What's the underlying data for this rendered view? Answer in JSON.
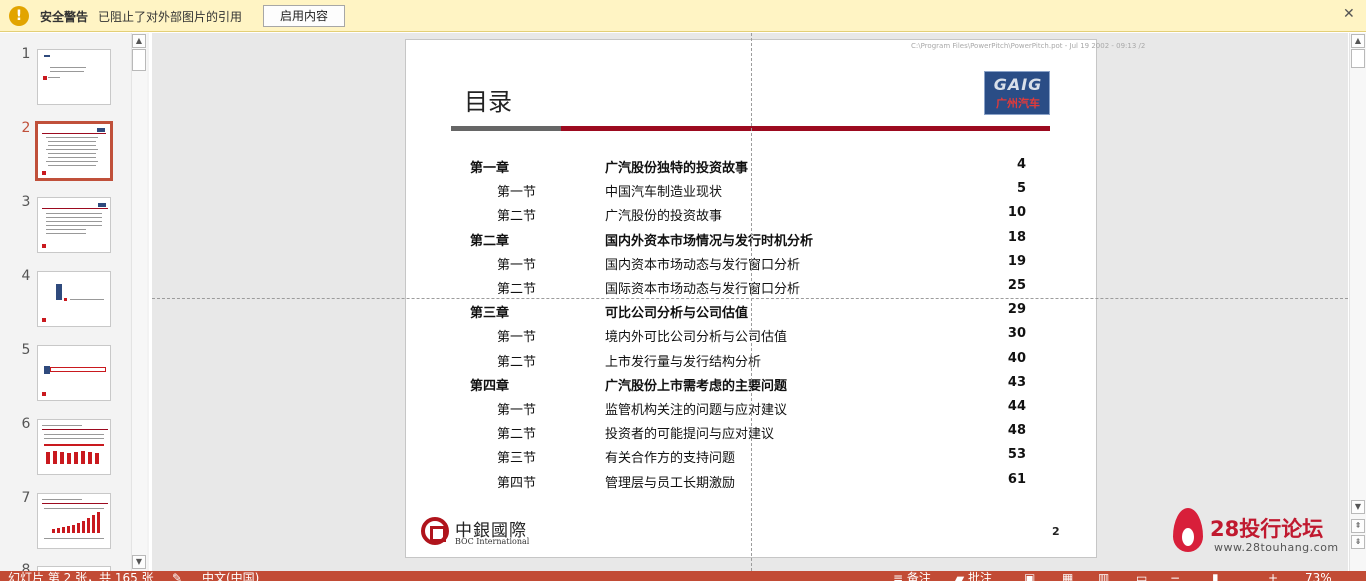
{
  "security_bar": {
    "icon": "warning-shield-icon",
    "title": "安全警告",
    "message": "已阻止了对外部图片的引用",
    "enable_button": "启用内容"
  },
  "thumbnails": [
    {
      "num": "1",
      "active": false
    },
    {
      "num": "2",
      "active": true
    },
    {
      "num": "3",
      "active": false
    },
    {
      "num": "4",
      "active": false
    },
    {
      "num": "5",
      "active": false
    },
    {
      "num": "6",
      "active": false
    },
    {
      "num": "7",
      "active": false
    },
    {
      "num": "8",
      "active": false
    }
  ],
  "slide": {
    "file_path": "C:\\Program Files\\PowerPitch\\PowerPitch.pot - Jul 19 2002 - 09:13 /2",
    "title": "目录",
    "brand_logo": {
      "top": "GAIG",
      "bottom": "广州汽车"
    },
    "toc": [
      {
        "label": "第一章",
        "title": "广汽股份独特的投资故事",
        "page": "4",
        "chapter": true
      },
      {
        "label": "第一节",
        "title": "中国汽车制造业现状",
        "page": "5",
        "chapter": false
      },
      {
        "label": "第二节",
        "title": "广汽股份的投资故事",
        "page": "10",
        "chapter": false
      },
      {
        "label": "第二章",
        "title": "国内外资本市场情况与发行时机分析",
        "page": "18",
        "chapter": true
      },
      {
        "label": "第一节",
        "title": "国内资本市场动态与发行窗口分析",
        "page": "19",
        "chapter": false
      },
      {
        "label": "第二节",
        "title": "国际资本市场动态与发行窗口分析",
        "page": "25",
        "chapter": false
      },
      {
        "label": "第三章",
        "title": "可比公司分析与公司估值",
        "page": "29",
        "chapter": true
      },
      {
        "label": "第一节",
        "title": "境内外可比公司分析与公司估值",
        "page": "30",
        "chapter": false
      },
      {
        "label": "第二节",
        "title": "上市发行量与发行结构分析",
        "page": "40",
        "chapter": false
      },
      {
        "label": "第四章",
        "title": "广汽股份上市需考虑的主要问题",
        "page": "43",
        "chapter": true
      },
      {
        "label": "第一节",
        "title": "监管机构关注的问题与应对建议",
        "page": "44",
        "chapter": false
      },
      {
        "label": "第二节",
        "title": "投资者的可能提问与应对建议",
        "page": "48",
        "chapter": false
      },
      {
        "label": "第三节",
        "title": "有关合作方的支持问题",
        "page": "53",
        "chapter": false
      },
      {
        "label": "第四节",
        "title": "管理层与员工长期激励",
        "page": "61",
        "chapter": false
      }
    ],
    "footer_logo_cn": "中銀國際",
    "footer_logo_en": "BOC International",
    "page_number": "2"
  },
  "watermark": {
    "text": "28投行论坛",
    "url": "www.28touhang.com"
  },
  "status_bar": {
    "slide_info": "幻灯片 第 2 张，共 165 张",
    "language": "中文(中国)",
    "notes": "备注",
    "comments": "批注",
    "zoom": "73%"
  },
  "colors": {
    "accent": "#c24b35",
    "brand_red": "#9c0a1f",
    "security_bar": "#fff4c4"
  }
}
